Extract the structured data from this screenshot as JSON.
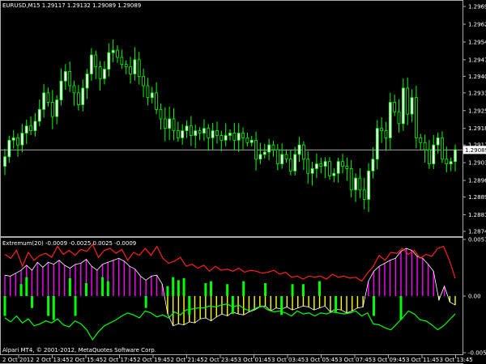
{
  "header": {
    "main_title": "EURUSD,M15  1.29117 1.29132 1.29089 1.29089",
    "indicator_title": "Extremum(20) -0.0009 -0.0025 0.0025 -0.0009",
    "copyright": "Alpari MT4, © 2001-2012, MetaQuotes Software Corp."
  },
  "price_axis": [
    "1.29695",
    "1.29620",
    "1.29545",
    "1.29470",
    "1.29400",
    "1.29330",
    "1.29255",
    "1.29180",
    "1.29110",
    "1.29035",
    "1.28960",
    "1.28890",
    "1.28815",
    "1.28745"
  ],
  "current_price_label": "1.29089",
  "indicator_axis": [
    "0.0057",
    "0.00",
    "-0.0057"
  ],
  "time_axis": [
    "2 Oct 2012",
    "2 Oct 13:45",
    "2 Oct 15:45",
    "2 Oct 17:45",
    "2 Oct 19:45",
    "2 Oct 21:45",
    "2 Oct 23:45",
    "3 Oct 01:45",
    "3 Oct 03:45",
    "3 Oct 05:45",
    "3 Oct 07:45",
    "3 Oct 09:45",
    "3 Oct 11:45",
    "3 Oct 13:45"
  ],
  "colors": {
    "background": "#000000",
    "candle": "#00ff00",
    "bull_fill": "#ffffff",
    "bear_fill": "#000000",
    "red_line": "#ff2020",
    "green_line": "#00ff00",
    "magenta": "#ff00ff",
    "yellow": "#ffff00",
    "axis_text": "#ffffff"
  },
  "chart_data": [
    {
      "type": "candlestick",
      "title": "EURUSD,M15",
      "close": [
        1.2906,
        1.2913,
        1.2914,
        1.2911,
        1.2916,
        1.2919,
        1.2917,
        1.2921,
        1.2926,
        1.2933,
        1.2929,
        1.2923,
        1.293,
        1.2938,
        1.2942,
        1.2936,
        1.2933,
        1.2928,
        1.2935,
        1.2941,
        1.2949,
        1.2944,
        1.2939,
        1.2943,
        1.295,
        1.2951,
        1.2948,
        1.2945,
        1.2944,
        1.2941,
        1.2947,
        1.294,
        1.2936,
        1.2931,
        1.2933,
        1.2926,
        1.2922,
        1.2918,
        1.2922,
        1.2917,
        1.2914,
        1.2917,
        1.2919,
        1.2915,
        1.2917,
        1.2916,
        1.2918,
        1.2914,
        1.2917,
        1.2915,
        1.2913,
        1.2915,
        1.2916,
        1.2913,
        1.2916,
        1.2914,
        1.2912,
        1.2913,
        1.2905,
        1.2907,
        1.2908,
        1.2911,
        1.2909,
        1.2903,
        1.2907,
        1.2905,
        1.29,
        1.2907,
        1.2911,
        1.2905,
        1.2899,
        1.2901,
        1.2903,
        1.2902,
        1.2904,
        1.2898,
        1.2899,
        1.2904,
        1.2902,
        1.2901,
        1.2892,
        1.2897,
        1.2892,
        1.2888,
        1.29,
        1.2905,
        1.2918,
        1.2917,
        1.2914,
        1.2929,
        1.2925,
        1.292,
        1.2935,
        1.2924,
        1.2931,
        1.2914,
        1.2912,
        1.2909,
        1.2903,
        1.2911,
        1.2914,
        1.2905,
        1.2903,
        1.2904,
        1.2909
      ],
      "price_low": 1.28745,
      "price_high": 1.29695,
      "current": 1.29089
    },
    {
      "type": "line",
      "title": "Extremum(20)",
      "series_red": [
        0.0042,
        0.0038,
        0.0046,
        0.003,
        0.0044,
        0.0036,
        0.0041,
        0.0043,
        0.0039,
        0.005,
        0.0042,
        0.0046,
        0.0041,
        0.0047,
        0.0045,
        0.0052,
        0.0039,
        0.0046,
        0.0048,
        0.0043,
        0.0047,
        0.0036,
        0.0044,
        0.0041,
        0.0048,
        0.0041,
        0.005,
        0.0038,
        0.0033,
        0.0035,
        0.0039,
        0.003,
        0.0032,
        0.0028,
        0.0031,
        0.0025,
        0.003,
        0.0026,
        0.0027,
        0.0025,
        0.0028,
        0.0024,
        0.0026,
        0.0025,
        0.0023,
        0.0024,
        0.0026,
        0.0022,
        0.0024,
        0.0019,
        0.002,
        0.0017,
        0.002,
        0.0019,
        0.002,
        0.0017,
        0.0022,
        0.0019,
        0.002,
        0.0018,
        0.0019,
        0.0015,
        0.0023,
        0.003,
        0.0041,
        0.0036,
        0.0044,
        0.0043,
        0.0048,
        0.0042,
        0.0046,
        0.0038,
        0.0042,
        0.004,
        0.0048,
        0.005,
        0.0036,
        0.0018
      ],
      "series_green": [
        -0.0022,
        -0.0026,
        -0.002,
        -0.0027,
        -0.0023,
        -0.003,
        -0.0028,
        -0.0025,
        -0.0027,
        -0.0023,
        -0.0029,
        -0.0031,
        -0.0025,
        -0.0028,
        -0.0034,
        -0.0044,
        -0.0036,
        -0.003,
        -0.0027,
        -0.0024,
        -0.002,
        -0.0017,
        -0.0019,
        -0.0022,
        -0.0015,
        -0.0017,
        -0.0021,
        -0.0019,
        -0.0022,
        -0.0016,
        -0.0019,
        -0.0014,
        -0.0013,
        -0.0012,
        -0.0012,
        -0.001,
        -0.0011,
        -0.0009,
        -0.0008,
        -0.0011,
        -0.0009,
        -0.0013,
        -0.0015,
        -0.0012,
        -0.001,
        -0.0014,
        -0.0016,
        -0.0015,
        -0.0017,
        -0.002,
        -0.0015,
        -0.0018,
        -0.0017,
        -0.002,
        -0.0017,
        -0.0018,
        -0.0016,
        -0.0017,
        -0.0018,
        -0.0017,
        -0.0015,
        -0.002,
        -0.0017,
        -0.0028,
        -0.0029,
        -0.0032,
        -0.0034,
        -0.0028,
        -0.0022,
        -0.0015,
        -0.0018,
        -0.0024,
        -0.0025,
        -0.0029,
        -0.0034,
        -0.003,
        -0.0024,
        -0.0018
      ],
      "histogram": [
        0.0021,
        0.002,
        0.0023,
        0.0026,
        0.0031,
        0.0026,
        0.0034,
        0.0029,
        0.0034,
        0.0032,
        0.0036,
        0.0031,
        0.0028,
        0.0032,
        0.0033,
        0.0037,
        0.003,
        0.0026,
        0.0032,
        0.0034,
        0.0036,
        0.0038,
        0.0035,
        0.003,
        0.0027,
        0.002,
        0.0016,
        0.002,
        0.0021,
        0.0012,
        -0.0018,
        -0.003,
        -0.0028,
        -0.0029,
        -0.0026,
        -0.0027,
        -0.0023,
        -0.0022,
        -0.0025,
        -0.0021,
        -0.0018,
        -0.002,
        -0.0016,
        -0.0018,
        -0.0019,
        -0.0016,
        -0.0014,
        -0.0011,
        -0.001,
        -0.0015,
        -0.0012,
        -0.0013,
        -0.0011,
        -0.0014,
        -0.0012,
        -0.001,
        -0.0011,
        -0.0014,
        -0.0012,
        -0.001,
        -0.0016,
        -0.0013,
        -0.0014,
        -0.0017,
        -0.0015,
        -0.0012,
        -0.0011,
        0.0015,
        0.0025,
        0.003,
        0.0033,
        0.0036,
        0.0038,
        0.0045,
        0.0048,
        0.0046,
        0.004,
        0.0038,
        0.0032,
        0.0025,
        -0.0004,
        0.001,
        -0.0006,
        -0.0009
      ],
      "spikes": [
        -0.002,
        0,
        0,
        0.0012,
        0.0019,
        -0.0012,
        0,
        0,
        -0.002,
        -0.0024,
        0,
        0,
        0.0018,
        -0.002,
        0,
        0.0013,
        0,
        0,
        0.0019,
        0.0015,
        0,
        0,
        0,
        0,
        0,
        0,
        -0.0012,
        0,
        0,
        0,
        0.001,
        0.0019,
        0.0016,
        0.0018,
        -0.0019,
        0,
        0,
        0.0013,
        0.0015,
        0,
        0,
        0.0012,
        -0.0018,
        0,
        0.0015,
        0,
        0,
        0,
        0.0013,
        0,
        0,
        -0.0019,
        0,
        0.0012,
        0,
        0.0012,
        0,
        0,
        0.0015,
        0,
        0,
        -0.0016,
        0,
        0,
        0,
        0,
        0,
        0,
        -0.002,
        0,
        0,
        0,
        0,
        -0.0024,
        0,
        0,
        0,
        0,
        0,
        0,
        0,
        0,
        0,
        0
      ],
      "ylim": [
        -0.0057,
        0.0057
      ]
    }
  ]
}
